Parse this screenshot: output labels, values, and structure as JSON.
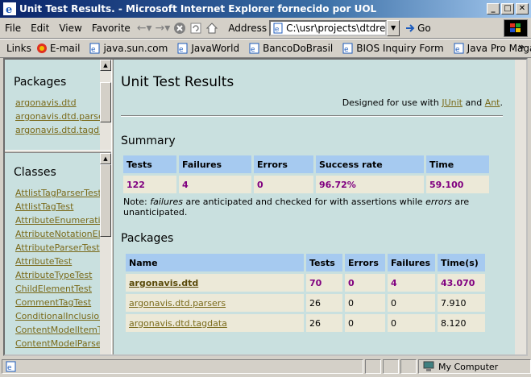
{
  "window": {
    "title": "Unit Test Results. - Microsoft Internet Explorer fornecido por UOL",
    "minimize": "_",
    "maximize": "□",
    "close": "✕"
  },
  "menu": {
    "items": [
      "File",
      "Edit",
      "View",
      "Favorite"
    ],
    "address_label": "Address",
    "address_value": "C:\\usr\\projects\\dtdreader",
    "go_label": "Go"
  },
  "links": {
    "label": "Links",
    "items": [
      "E-mail",
      "java.sun.com",
      "JavaWorld",
      "BancoDoBrasil",
      "BIOS Inquiry Form",
      "Java Pro Magazine"
    ],
    "more": "»"
  },
  "sidebar": {
    "packages_heading": "Packages",
    "packages": [
      "argonavis.dtd",
      "argonavis.dtd.parsers",
      "argonavis.dtd.tagdata"
    ],
    "classes_heading": "Classes",
    "classes": [
      "AttlistTagParserTest",
      "AttlistTagTest",
      "AttributeEnumerationTest",
      "AttributeNotationElement",
      "AttributeParserTest",
      "AttributeTest",
      "AttributeTypeTest",
      "ChildElementTest",
      "CommentTagTest",
      "ConditionalInclusionTest",
      "ContentModelItemTest",
      "ContentModelParserTest"
    ]
  },
  "main": {
    "title": "Unit Test Results",
    "designed_prefix": "Designed for use with ",
    "junit_link": "JUnit",
    "designed_and": " and ",
    "ant_link": "Ant",
    "designed_suffix": ".",
    "summary_heading": "Summary",
    "summary_headers": [
      "Tests",
      "Failures",
      "Errors",
      "Success rate",
      "Time"
    ],
    "summary_values": [
      "122",
      "4",
      "0",
      "96.72%",
      "59.100"
    ],
    "note_prefix": "Note: ",
    "note_failures": "failures",
    "note_middle": " are anticipated and checked for with assertions while ",
    "note_errors": "errors",
    "note_suffix": " are unanticipated.",
    "packages_heading": "Packages",
    "packages_headers": [
      "Name",
      "Tests",
      "Errors",
      "Failures",
      "Time(s)"
    ],
    "packages_rows": [
      {
        "name": "argonavis.dtd",
        "tests": "70",
        "errors": "0",
        "failures": "4",
        "time": "43.070"
      },
      {
        "name": "argonavis.dtd.parsers",
        "tests": "26",
        "errors": "0",
        "failures": "0",
        "time": "7.910"
      },
      {
        "name": "argonavis.dtd.tagdata",
        "tests": "26",
        "errors": "0",
        "failures": "0",
        "time": "8.120"
      }
    ]
  },
  "status": {
    "main_text": "",
    "zone": "My Computer"
  },
  "colors": {
    "page_bg": "#c9e0df",
    "header_bg": "#a6caf0",
    "cell_bg": "#ece9d8",
    "failure_purple": "#800080",
    "link_olive": "#7a6a1a"
  }
}
